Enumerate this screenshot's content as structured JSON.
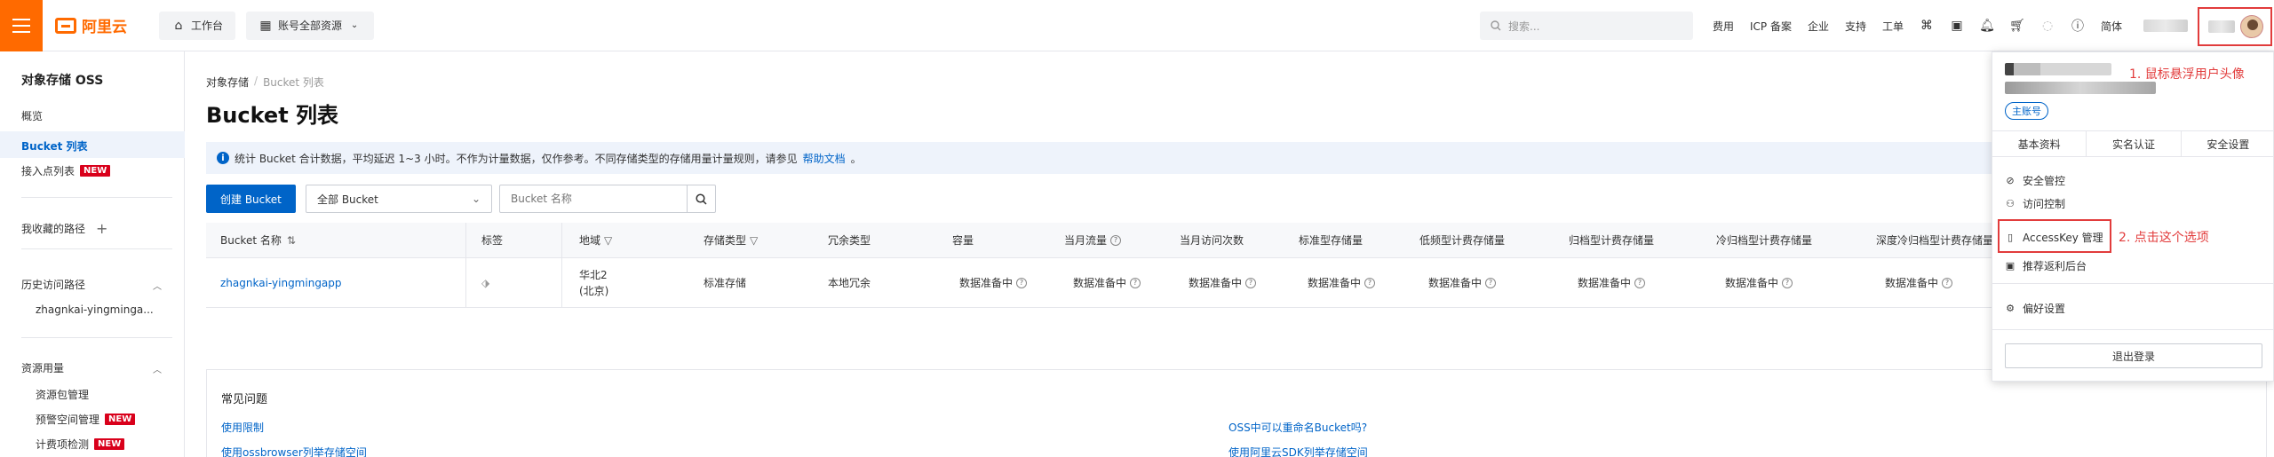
{
  "topbar": {
    "logo_text": "阿里云",
    "workbench": "工作台",
    "account_resources": "账号全部资源",
    "search_placeholder": "搜索...",
    "links": [
      "费用",
      "ICP 备案",
      "企业",
      "支持",
      "工单"
    ],
    "lang": "简体"
  },
  "sidebar": {
    "title": "对象存储 OSS",
    "overview": "概览",
    "bucket_list": "Bucket 列表",
    "access_points": "接入点列表",
    "favorites": "我收藏的路径",
    "history": "历史访问路径",
    "history_item": "zhagnkai-yingminga...",
    "resource_usage": "资源用量",
    "resource_pkg": "资源包管理",
    "alert_mgmt": "预警空间管理",
    "metering": "计费项检测",
    "new_badge": "NEW"
  },
  "main": {
    "breadcrumb": [
      "对象存储",
      "Bucket 列表"
    ],
    "title": "Bucket 列表",
    "notice": "统计 Bucket 合计数据，平均延迟 1~3 小时。不作为计量数据，仅作参考。不同存储类型的存储用量计量规则，请参见",
    "notice_link": "帮助文档",
    "notice_end": "。",
    "create_button": "创建 Bucket",
    "filter_select": "全部 Bucket",
    "search_placeholder": "Bucket 名称",
    "columns": [
      "Bucket 名称",
      "标签",
      "地域",
      "存储类型",
      "冗余类型",
      "容量",
      "当月流量",
      "当月访问次数",
      "标准型存储量",
      "低频型计费存储量",
      "归档型计费存储量",
      "冷归档型计费存储量",
      "深度冷归档型计费存储量"
    ],
    "row": {
      "name": "zhagnkai-yingmingapp",
      "region_line1": "华北2",
      "region_line2": "(北京)",
      "storage": "标准存储",
      "redundancy": "本地冗余",
      "pending": "数据准备中"
    },
    "faq_title": "常见问题",
    "faq_links": [
      "使用限制",
      "使用ossbrowser列举存储空间",
      "OSS中可以重命名Bucket吗?",
      "使用阿里云SDK列举存储空间"
    ]
  },
  "dropdown": {
    "account_tag": "主账号",
    "annotation1": "1. 鼠标悬浮用户头像",
    "tabs": [
      "基本资料",
      "实名认证",
      "安全设置"
    ],
    "items": [
      "安全管控",
      "访问控制",
      "AccessKey 管理",
      "推荐返利后台",
      "偏好设置"
    ],
    "annotation2": "2. 点击这个选项",
    "logout": "退出登录"
  },
  "colors": {
    "accent": "#ff6a00",
    "primary": "#0064c8",
    "annotation": "#e23c3c",
    "badge": "#d9001b"
  }
}
